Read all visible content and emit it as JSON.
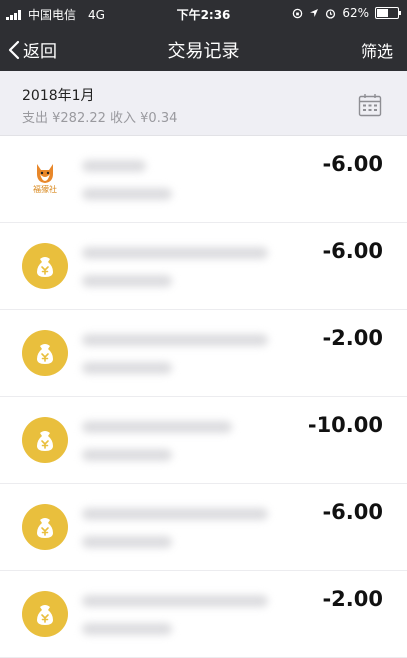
{
  "status_bar": {
    "carrier": "中国电信",
    "network": "4G",
    "time": "下午2:36",
    "battery": "62%",
    "battery_level": 0.62
  },
  "nav": {
    "back_label": "返回",
    "title": "交易记录",
    "filter_label": "筛选"
  },
  "month": {
    "title": "2018年1月",
    "summary": "支出 ¥282.22 收入 ¥0.34"
  },
  "transactions": [
    {
      "icon": "fox-logo-icon",
      "logo_text": "福獴社",
      "amount": "-6.00"
    },
    {
      "icon": "money-bag-icon",
      "amount": "-6.00"
    },
    {
      "icon": "money-bag-icon",
      "amount": "-2.00"
    },
    {
      "icon": "money-bag-icon",
      "amount": "-10.00"
    },
    {
      "icon": "money-bag-icon",
      "amount": "-6.00"
    },
    {
      "icon": "money-bag-icon",
      "amount": "-2.00"
    }
  ],
  "colors": {
    "nav_bg": "#2e2f33",
    "coin": "#e9bf3d",
    "header_bg": "#efeff4"
  }
}
